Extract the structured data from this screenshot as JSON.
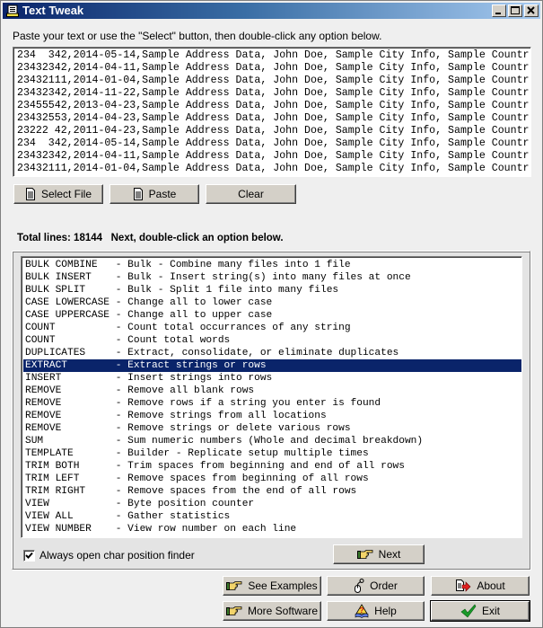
{
  "window": {
    "title": "Text Tweak",
    "controls": {
      "minimize": "_",
      "maximize": "□",
      "close": "×"
    }
  },
  "instructions": "Paste your text or use the \"Select\" button, then double-click any option below.",
  "text_lines": [
    "234  342,2014-05-14,Sample Address Data, John Doe, Sample City Info, Sample Countr",
    "23432342,2014-04-11,Sample Address Data, John Doe, Sample City Info, Sample Countr",
    "23432111,2014-01-04,Sample Address Data, John Doe, Sample City Info, Sample Countr",
    "23432342,2014-11-22,Sample Address Data, John Doe, Sample City Info, Sample Countr",
    "23455542,2013-04-23,Sample Address Data, John Doe, Sample City Info, Sample Countr",
    "23432553,2014-04-23,Sample Address Data, John Doe, Sample City Info, Sample Countr",
    "23222 42,2011-04-23,Sample Address Data, John Doe, Sample City Info, Sample Countr",
    "234  342,2014-05-14,Sample Address Data, John Doe, Sample City Info, Sample Countr",
    "23432342,2014-04-11,Sample Address Data, John Doe, Sample City Info, Sample Countr",
    "23432111,2014-01-04,Sample Address Data, John Doe, Sample City Info, Sample Countr"
  ],
  "file_buttons": {
    "select_file": "Select File",
    "paste": "Paste",
    "clear": "Clear"
  },
  "status": {
    "total_lines_label": "Total lines: 18144",
    "next_hint": "Next, double-click an option below."
  },
  "options": [
    {
      "name": "BULK COMBINE",
      "desc": "Bulk - Combine many files into 1 file",
      "selected": false
    },
    {
      "name": "BULK INSERT",
      "desc": "Bulk - Insert string(s) into many files at once",
      "selected": false
    },
    {
      "name": "BULK SPLIT",
      "desc": "Bulk - Split 1 file into many files",
      "selected": false
    },
    {
      "name": "CASE LOWERCASE",
      "desc": "Change all to lower case",
      "selected": false
    },
    {
      "name": "CASE UPPERCASE",
      "desc": "Change all to upper case",
      "selected": false
    },
    {
      "name": "COUNT",
      "desc": "Count total occurrances of any string",
      "selected": false
    },
    {
      "name": "COUNT",
      "desc": "Count total words",
      "selected": false
    },
    {
      "name": "DUPLICATES",
      "desc": "Extract, consolidate, or eliminate duplicates",
      "selected": false
    },
    {
      "name": "EXTRACT",
      "desc": "Extract strings or rows",
      "selected": true
    },
    {
      "name": "INSERT",
      "desc": "Insert strings into rows",
      "selected": false
    },
    {
      "name": "REMOVE",
      "desc": "Remove all blank rows",
      "selected": false
    },
    {
      "name": "REMOVE",
      "desc": "Remove rows if a string you enter is found",
      "selected": false
    },
    {
      "name": "REMOVE",
      "desc": "Remove strings from all locations",
      "selected": false
    },
    {
      "name": "REMOVE",
      "desc": "Remove strings or delete various rows",
      "selected": false
    },
    {
      "name": "SUM",
      "desc": "Sum numeric numbers (Whole and decimal breakdown)",
      "selected": false
    },
    {
      "name": "TEMPLATE",
      "desc": "Builder - Replicate setup multiple times",
      "selected": false
    },
    {
      "name": "TRIM BOTH",
      "desc": "Trim spaces from beginning and end of all rows",
      "selected": false
    },
    {
      "name": "TRIM LEFT",
      "desc": "Remove spaces from beginning of all rows",
      "selected": false
    },
    {
      "name": "TRIM RIGHT",
      "desc": "Remove spaces from the end of all rows",
      "selected": false
    },
    {
      "name": "VIEW",
      "desc": "Byte position counter",
      "selected": false
    },
    {
      "name": "VIEW ALL",
      "desc": "Gather statistics",
      "selected": false
    },
    {
      "name": "VIEW NUMBER",
      "desc": "View row number on each line",
      "selected": false
    }
  ],
  "checkbox": {
    "label": "Always open char position finder",
    "checked": true
  },
  "next_button": "Next",
  "bottom_buttons": {
    "see_examples": "See Examples",
    "order": "Order",
    "about": "About",
    "more_software": "More Software",
    "help": "Help",
    "exit": "Exit"
  },
  "colors": {
    "selection_bg": "#0a246a",
    "selection_fg": "#ffffff",
    "button_face": "#d4d0c8",
    "window_bg": "#efefef"
  }
}
